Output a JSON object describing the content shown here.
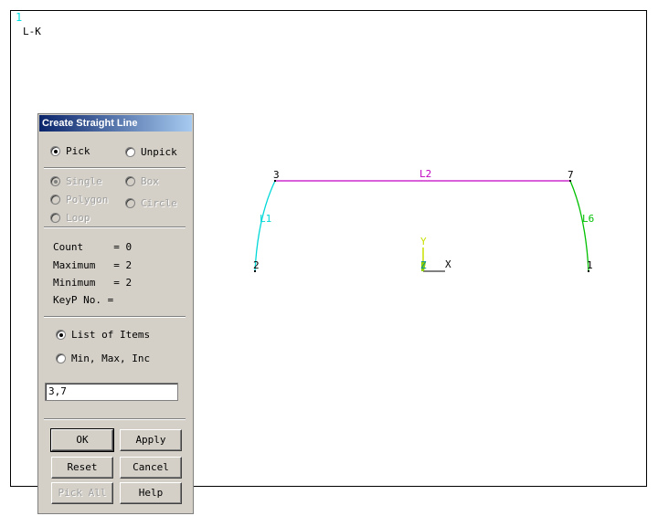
{
  "viewport": {
    "window_number": "1",
    "title": "L-K"
  },
  "graphics": {
    "keypoint_labels": [
      "3",
      "7",
      "2",
      "1"
    ],
    "line_labels": [
      "L2",
      "L1",
      "L6"
    ],
    "axis_labels": {
      "x": "X",
      "y": "Y",
      "z": "Z"
    },
    "colors": {
      "line_L2": "#c000c0",
      "line_L1": "#00d8d8",
      "line_L6": "#00c000",
      "axis_y": "#c8e000"
    }
  },
  "dialog": {
    "title": "Create Straight Line",
    "pick_label": "Pick",
    "unpick_label": "Unpick",
    "single_label": "Single",
    "box_label": "Box",
    "polygon_label": "Polygon",
    "circle_label": "Circle",
    "loop_label": "Loop",
    "count_label": "Count     =",
    "count_value": "0",
    "maximum_label": "Maximum   =",
    "maximum_value": "2",
    "minimum_label": "Minimum   =",
    "minimum_value": "2",
    "keyp_label": "KeyP No. =",
    "list_items_label": "List of Items",
    "minmaxinc_label": "Min, Max, Inc",
    "input_value": "3,7",
    "ok_label": "OK",
    "apply_label": "Apply",
    "reset_label": "Reset",
    "cancel_label": "Cancel",
    "pickall_label": "Pick All",
    "help_label": "Help"
  }
}
